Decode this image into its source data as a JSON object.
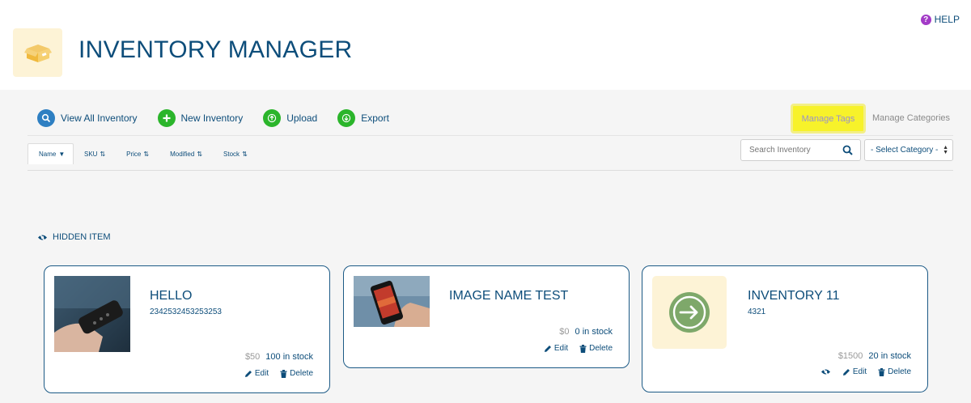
{
  "help": {
    "label": "HELP",
    "icon": "help-circle-icon",
    "color": "#a33bc7"
  },
  "header": {
    "title": "INVENTORY MANAGER",
    "logo_icon": "box-icon"
  },
  "toolbar": {
    "view_all": "View All Inventory",
    "new_inventory": "New Inventory",
    "upload": "Upload",
    "export": "Export",
    "manage_tags": "Manage Tags",
    "manage_categories": "Manage Categories"
  },
  "sort": {
    "name": "Name",
    "sku": "SKU",
    "price": "Price",
    "modified": "Modified",
    "stock": "Stock"
  },
  "search": {
    "placeholder": "Search Inventory"
  },
  "category_select": {
    "selected": "- Select Category -"
  },
  "hidden_item_label": "HIDDEN ITEM",
  "items": [
    {
      "name": "HELLO",
      "sku": "2342532453253253",
      "price": "$50",
      "stock": "100 in stock",
      "edit": "Edit",
      "delete": "Delete"
    },
    {
      "name": "IMAGE NAME TEST",
      "sku": "",
      "price": "$0",
      "stock": "0 in stock",
      "edit": "Edit",
      "delete": "Delete"
    },
    {
      "name": "INVENTORY 11",
      "sku": "4321",
      "price": "$1500",
      "stock": "20 in stock",
      "edit": "Edit",
      "delete": "Delete"
    }
  ],
  "colors": {
    "accent": "#0d4d7a",
    "highlight": "#f7f22a",
    "blue_button": "#2e7fc2",
    "green_button": "#2bb52b"
  }
}
